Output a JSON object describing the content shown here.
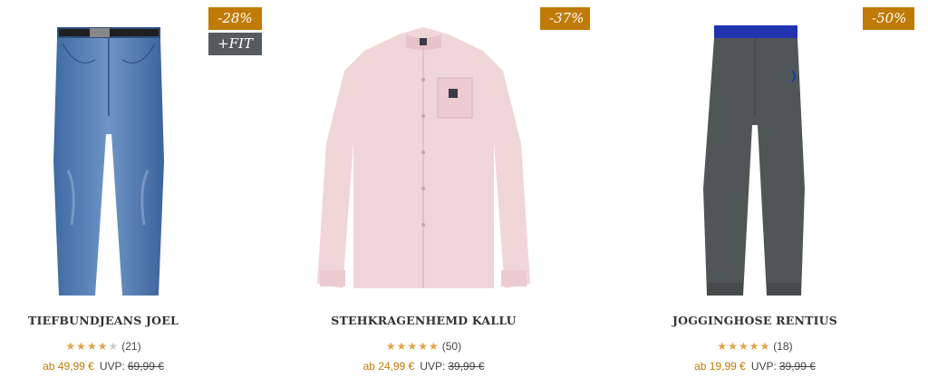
{
  "products": [
    {
      "name": "TIEFBUNDJEANS JOEL",
      "badges": [
        "-28%",
        "+FIT"
      ],
      "stars_filled": 4,
      "stars_total": 5,
      "review_count": "(21)",
      "price_prefix": "ab 49,99 €",
      "uvp_label": "UVP:",
      "uvp_price": "69,99 €",
      "image_icon": "jeans-image"
    },
    {
      "name": "STEHKRAGENHEMD KALLU",
      "badges": [
        "-37%"
      ],
      "stars_filled": 5,
      "stars_total": 5,
      "review_count": "(50)",
      "price_prefix": "ab 24,99 €",
      "uvp_label": "UVP:",
      "uvp_price": "39,99 €",
      "image_icon": "shirt-image"
    },
    {
      "name": "JOGGINGHOSE RENTIUS",
      "badges": [
        "-50%"
      ],
      "stars_filled": 5,
      "stars_total": 5,
      "review_count": "(18)",
      "price_prefix": "ab 19,99 €",
      "uvp_label": "UVP:",
      "uvp_price": "39,99 €",
      "image_icon": "joggers-image"
    }
  ],
  "colors": {
    "badge_discount": "#c07a06",
    "badge_fit": "#555a5e",
    "star": "#e2a348",
    "price": "#c07a06"
  }
}
